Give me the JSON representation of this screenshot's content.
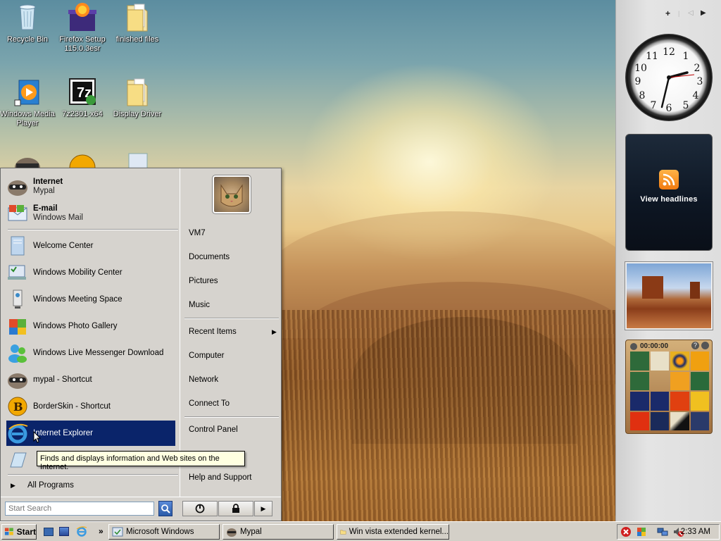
{
  "desktop": {
    "icons": [
      {
        "label": "Recycle Bin"
      },
      {
        "label": "Firefox Setup 115.0.3esr"
      },
      {
        "label": "finished files"
      },
      {
        "label": "Windows Media Player"
      },
      {
        "label": "7z2301-x64"
      },
      {
        "label": "Display Driver"
      }
    ]
  },
  "sidebar": {
    "add_label": "+",
    "prev_label": "◁",
    "next_label": "▶",
    "feed": {
      "label": "View headlines"
    },
    "puzzle": {
      "timer": "00:00:00",
      "help": "?"
    }
  },
  "start_menu": {
    "pinned": [
      {
        "title": "Internet",
        "sub": "Mypal"
      },
      {
        "title": "E-mail",
        "sub": "Windows Mail"
      }
    ],
    "recent": [
      {
        "label": "Welcome Center"
      },
      {
        "label": "Windows Mobility Center"
      },
      {
        "label": "Windows Meeting Space"
      },
      {
        "label": "Windows Photo Gallery"
      },
      {
        "label": "Windows Live Messenger Download"
      },
      {
        "label": "mypal - Shortcut"
      },
      {
        "label": "BorderSkin - Shortcut"
      },
      {
        "label": "Internet Explorer"
      }
    ],
    "all_programs": "All Programs",
    "right": {
      "user": "VM7",
      "documents": "Documents",
      "pictures": "Pictures",
      "music": "Music",
      "recent_items": "Recent Items",
      "computer": "Computer",
      "network": "Network",
      "connect_to": "Connect To",
      "control_panel": "Control Panel",
      "help": "Help and Support"
    },
    "search_placeholder": "Start Search",
    "tooltip": "Finds and displays information and Web sites on the Internet."
  },
  "taskbar": {
    "start_label": "Start",
    "tasks": [
      {
        "label": "Microsoft Windows"
      },
      {
        "label": "Mypal"
      },
      {
        "label": "Win vista extended kernel..."
      }
    ],
    "chevron": "»",
    "clock": "2:33 AM"
  }
}
